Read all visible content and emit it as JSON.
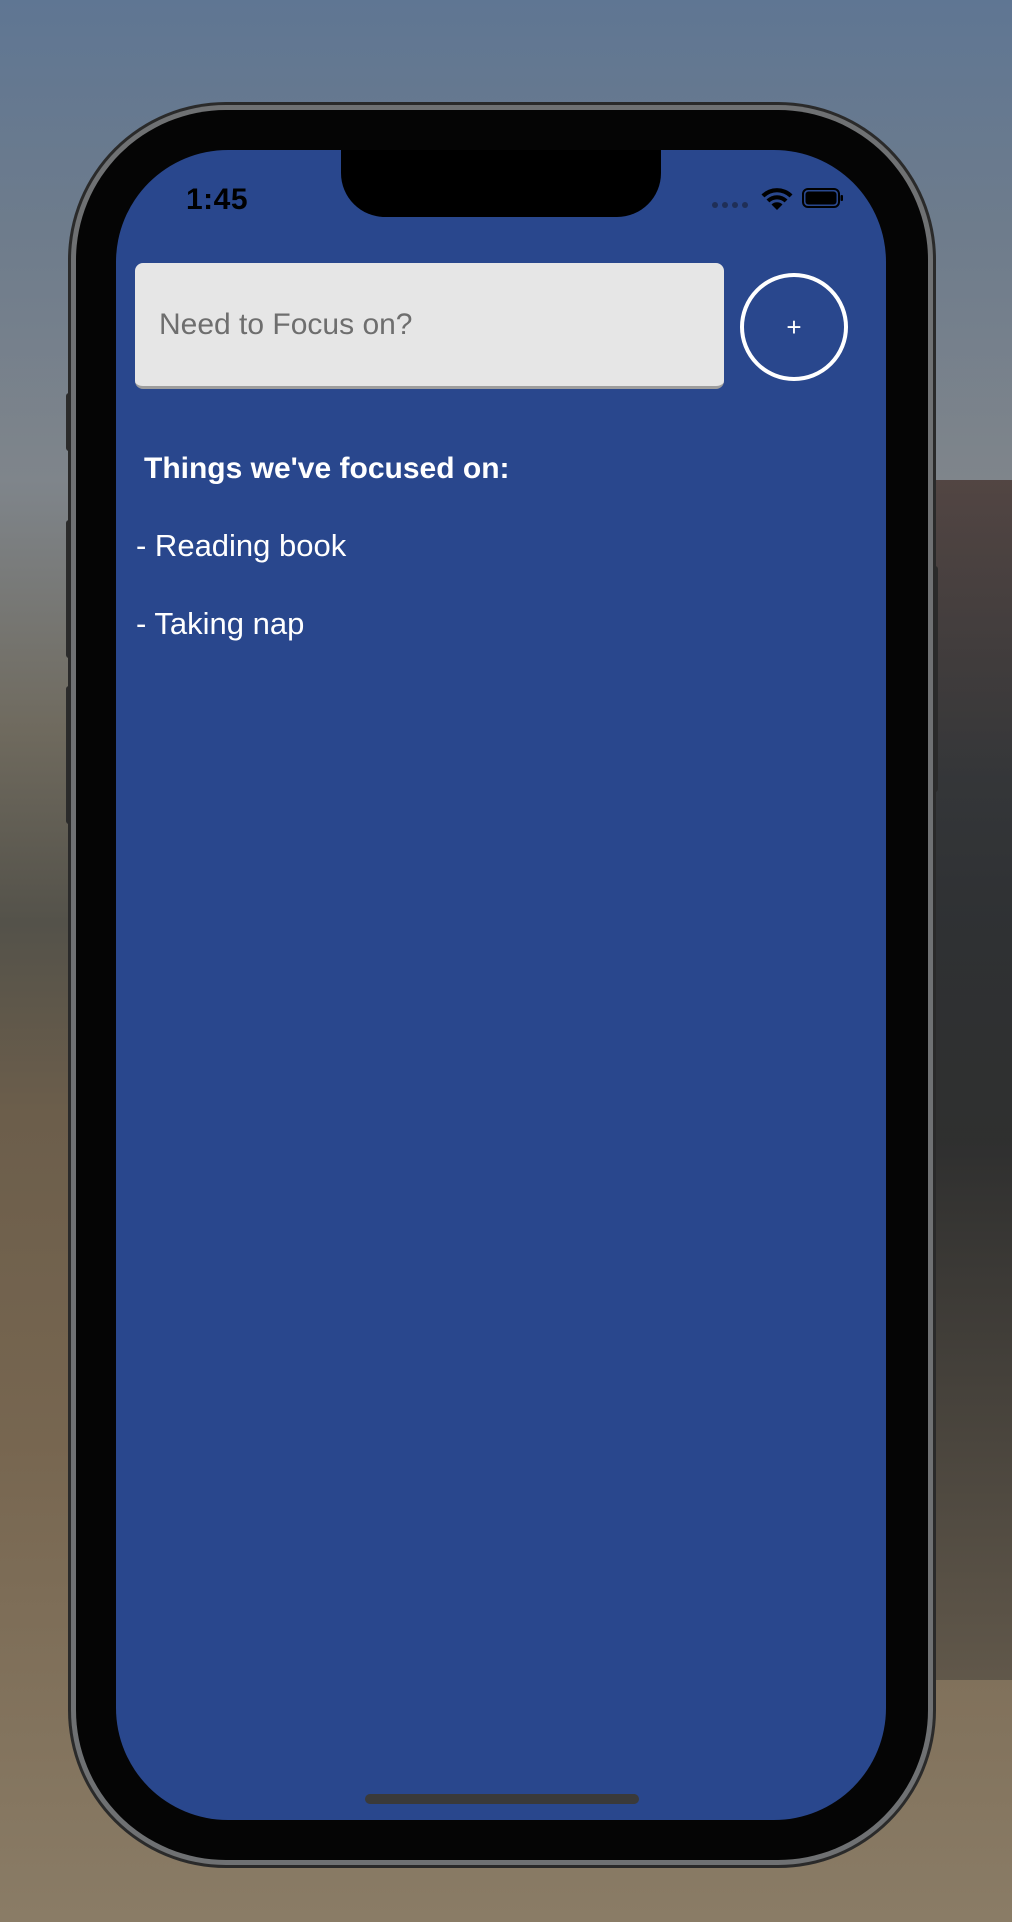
{
  "status_bar": {
    "time": "1:45",
    "wifi_icon": "wifi-icon",
    "battery_icon": "battery-icon"
  },
  "focus_input": {
    "value": "",
    "placeholder": "Need to Focus on?"
  },
  "add_button": {
    "label": "+"
  },
  "focused": {
    "heading": "Things we've focused on:",
    "items": [
      "- Reading book",
      "- Taking nap"
    ]
  },
  "colors": {
    "screen_background": "#29478d",
    "input_background": "#e6e6e6",
    "text": "#ffffff"
  }
}
